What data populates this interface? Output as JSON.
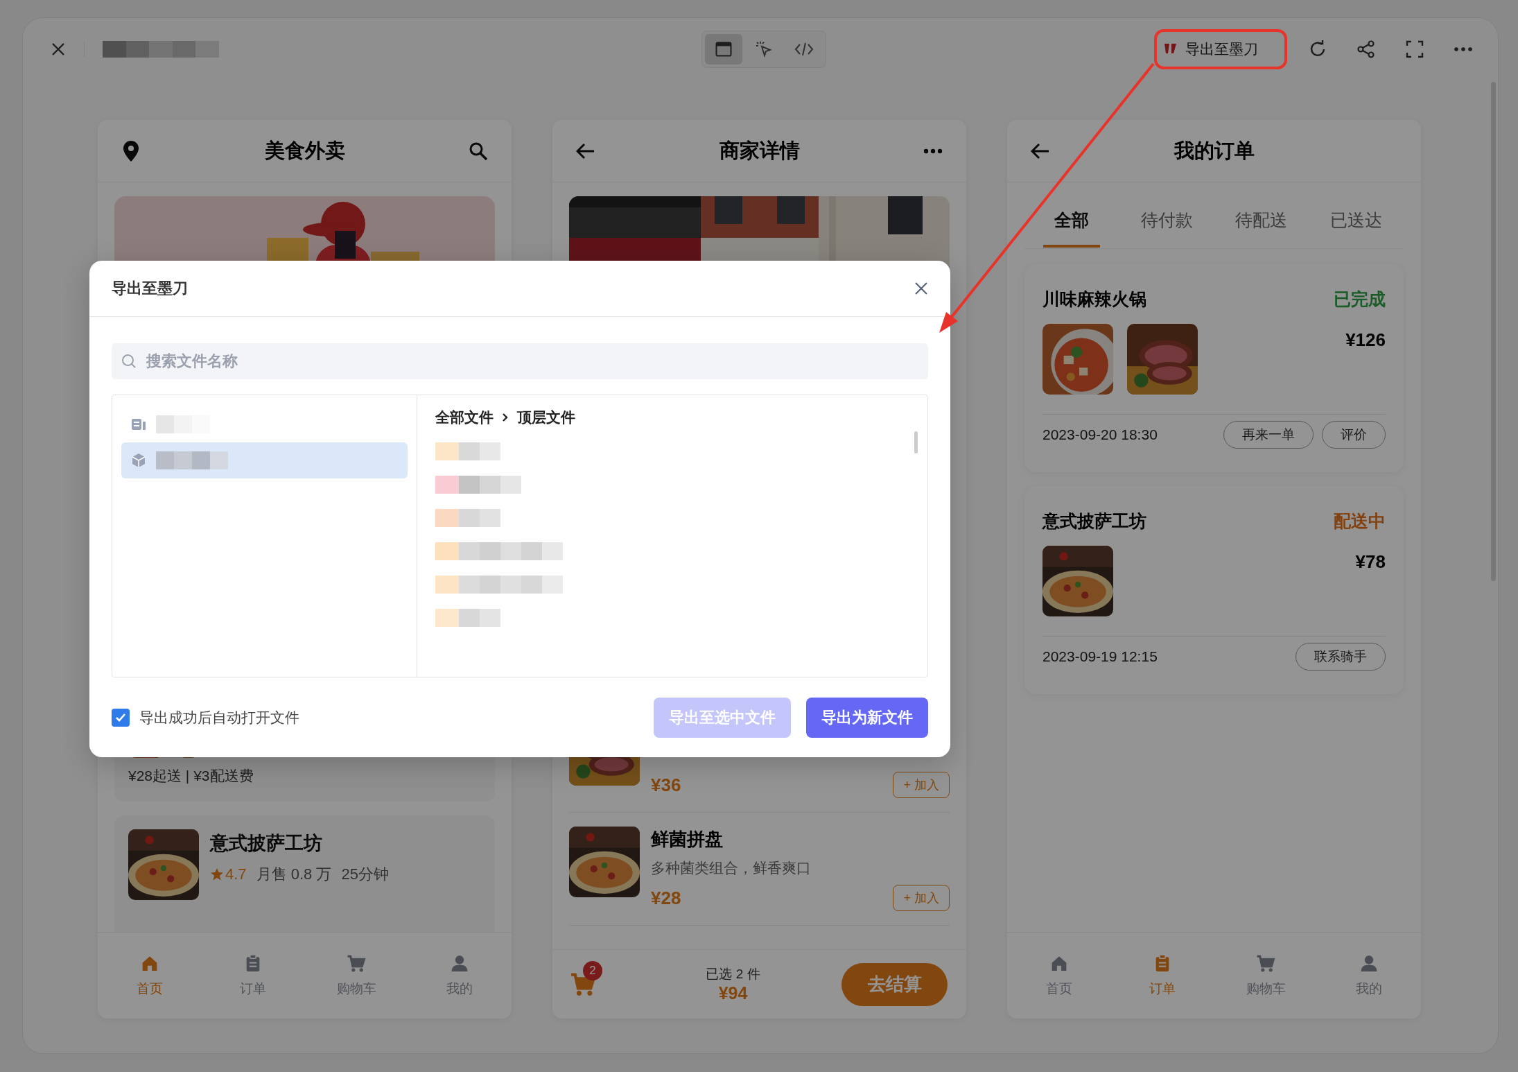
{
  "toolbar": {
    "modes": [
      {
        "selected": true
      },
      {
        "selected": false
      },
      {
        "selected": false
      }
    ],
    "export_button": "导出至墨刀"
  },
  "home_screen": {
    "title": "美食外卖",
    "restaurants": [
      {
        "delivery_info": "¥28起送 | ¥3配送费"
      },
      {
        "name": "意式披萨工坊",
        "rating": "4.7",
        "monthly_sales": "月售 0.8 万",
        "delivery_time": "25分钟"
      }
    ],
    "nav": [
      {
        "label": "首页",
        "selected": true
      },
      {
        "label": "订单",
        "selected": false
      },
      {
        "label": "购物车",
        "selected": false
      },
      {
        "label": "我的",
        "selected": false
      }
    ]
  },
  "shop_screen": {
    "title": "商家详情",
    "dishes": [
      {
        "price": "¥36",
        "add_button": "+ 加入"
      },
      {
        "name": "鲜菌拼盘",
        "description": "多种菌类组合，鲜香爽口",
        "price": "¥28",
        "add_button": "+ 加入"
      }
    ],
    "cart": {
      "count": "2",
      "selected_summary": "已选 2 件",
      "total": "¥94",
      "checkout_button": "去结算"
    }
  },
  "orders_screen": {
    "title": "我的订单",
    "tabs": [
      {
        "label": "全部",
        "selected": true
      },
      {
        "label": "待付款",
        "selected": false
      },
      {
        "label": "待配送",
        "selected": false
      },
      {
        "label": "已送达",
        "selected": false
      }
    ],
    "orders": [
      {
        "shop": "川味麻辣火锅",
        "status": "已完成",
        "kind": "completed",
        "price": "¥126",
        "images": [
          {
            "kind": "picture"
          },
          {
            "kind": "picture"
          }
        ],
        "time": "2023-09-20 18:30",
        "actions": [
          "再来一单",
          "评价"
        ]
      },
      {
        "shop": "意式披萨工坊",
        "status": "配送中",
        "kind": "delivering",
        "price": "¥78",
        "images": [
          {
            "kind": "picture"
          }
        ],
        "time": "2023-09-19 12:15",
        "actions": [
          "联系骑手"
        ]
      }
    ],
    "nav": [
      {
        "label": "首页",
        "selected": false
      },
      {
        "label": "订单",
        "selected": true
      },
      {
        "label": "购物车",
        "selected": false
      },
      {
        "label": "我的",
        "selected": false
      }
    ]
  },
  "modal": {
    "title": "导出至墨刀",
    "search_placeholder": "搜索文件名称",
    "tree": [
      {
        "selected": false
      },
      {
        "selected": true
      }
    ],
    "breadcrumb": [
      "全部文件",
      "顶层文件"
    ],
    "auto_open": {
      "label": "导出成功后自动打开文件",
      "checked": true
    },
    "buttons": [
      {
        "label": "导出至选中文件",
        "disabled": true
      },
      {
        "label": "导出为新文件",
        "disabled": false
      }
    ]
  }
}
